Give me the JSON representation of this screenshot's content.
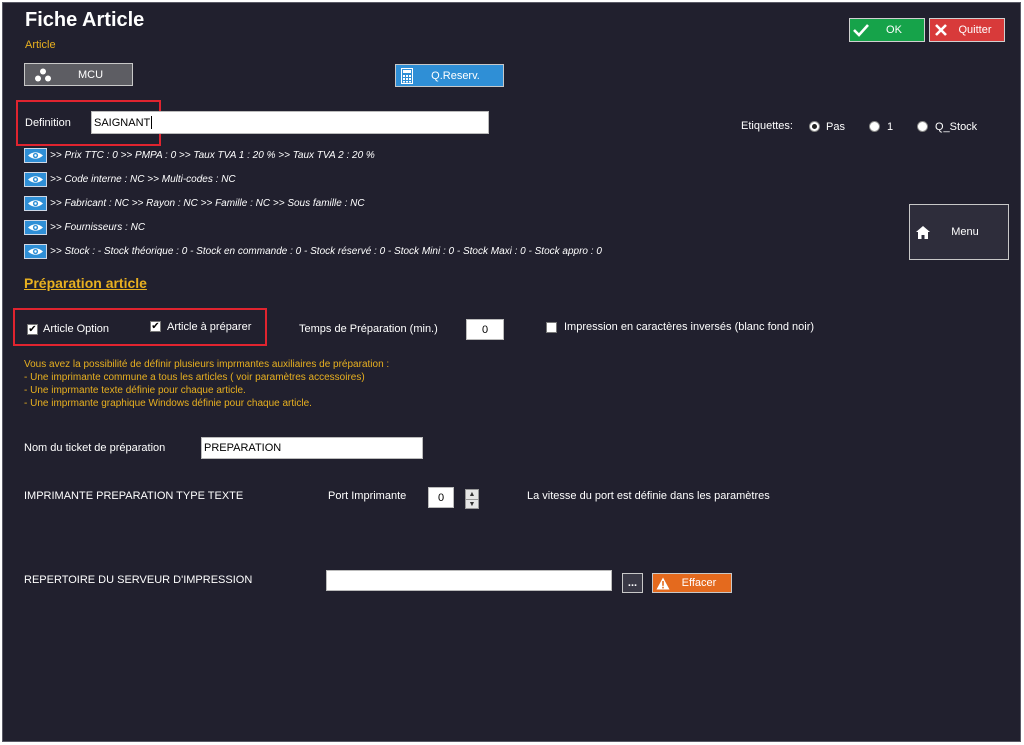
{
  "header": {
    "title": "Fiche Article",
    "subtitle": "Article"
  },
  "actions": {
    "ok_label": "OK",
    "quit_label": "Quitter"
  },
  "toolbar": {
    "mcu_label": "MCU",
    "qreserv_label": "Q.Reserv."
  },
  "definition": {
    "label": "Definition",
    "value": "SAIGNANT"
  },
  "etiquettes": {
    "label": "Etiquettes:",
    "options": [
      "Pas",
      "1",
      "Q_Stock"
    ],
    "selected": "Pas"
  },
  "info_lines": [
    ">> Prix TTC : 0 >> PMPA : 0 >> Taux TVA 1 : 20 % >> Taux TVA 2 : 20 %",
    ">> Code interne : NC >> Multi-codes : NC",
    ">> Fabricant : NC >> Rayon : NC >> Famille : NC >> Sous famille : NC",
    ">> Fournisseurs : NC",
    ">> Stock : - Stock théorique : 0 - Stock en commande : 0 - Stock réservé : 0 - Stock Mini : 0 - Stock Maxi : 0 - Stock appro : 0"
  ],
  "menu": {
    "label": "Menu"
  },
  "preparation": {
    "section_title": "Préparation article",
    "article_option_label": "Article Option",
    "article_option_checked": true,
    "article_a_preparer_label": "Article à préparer",
    "article_a_preparer_checked": true,
    "temps_label": "Temps de Préparation (min.)",
    "temps_value": "0",
    "impression_inverse_label": "Impression en caractères inversés (blanc fond noir)",
    "impression_inverse_checked": false,
    "help_lines": [
      "Vous avez la possibilité de définir plusieurs imprmantes auxiliaires de préparation :",
      "- Une imprimante commune a tous les articles ( voir paramètres accessoires)",
      "- Une imprmante texte définie pour chaque article.",
      "- Une imprmante graphique Windows définie pour chaque article."
    ],
    "ticket_label": "Nom du ticket de préparation",
    "ticket_value": "PREPARATION",
    "imprimante_texte_label": "IMPRIMANTE PREPARATION TYPE TEXTE",
    "port_label": "Port Imprimante",
    "port_value": "0",
    "port_note": "La vitesse du port est définie dans les paramètres",
    "repertoire_label": "REPERTOIRE DU SERVEUR D'IMPRESSION",
    "repertoire_value": "",
    "browse_label": "...",
    "effacer_label": "Effacer"
  },
  "colors": {
    "background": "#21202e",
    "accent_yellow": "#e8b020",
    "ok_green": "#16a34a",
    "quit_red": "#d83a3a",
    "info_blue": "#2f8fd6",
    "effacer_orange": "#e46a1e",
    "highlight_red": "#e0242f"
  }
}
